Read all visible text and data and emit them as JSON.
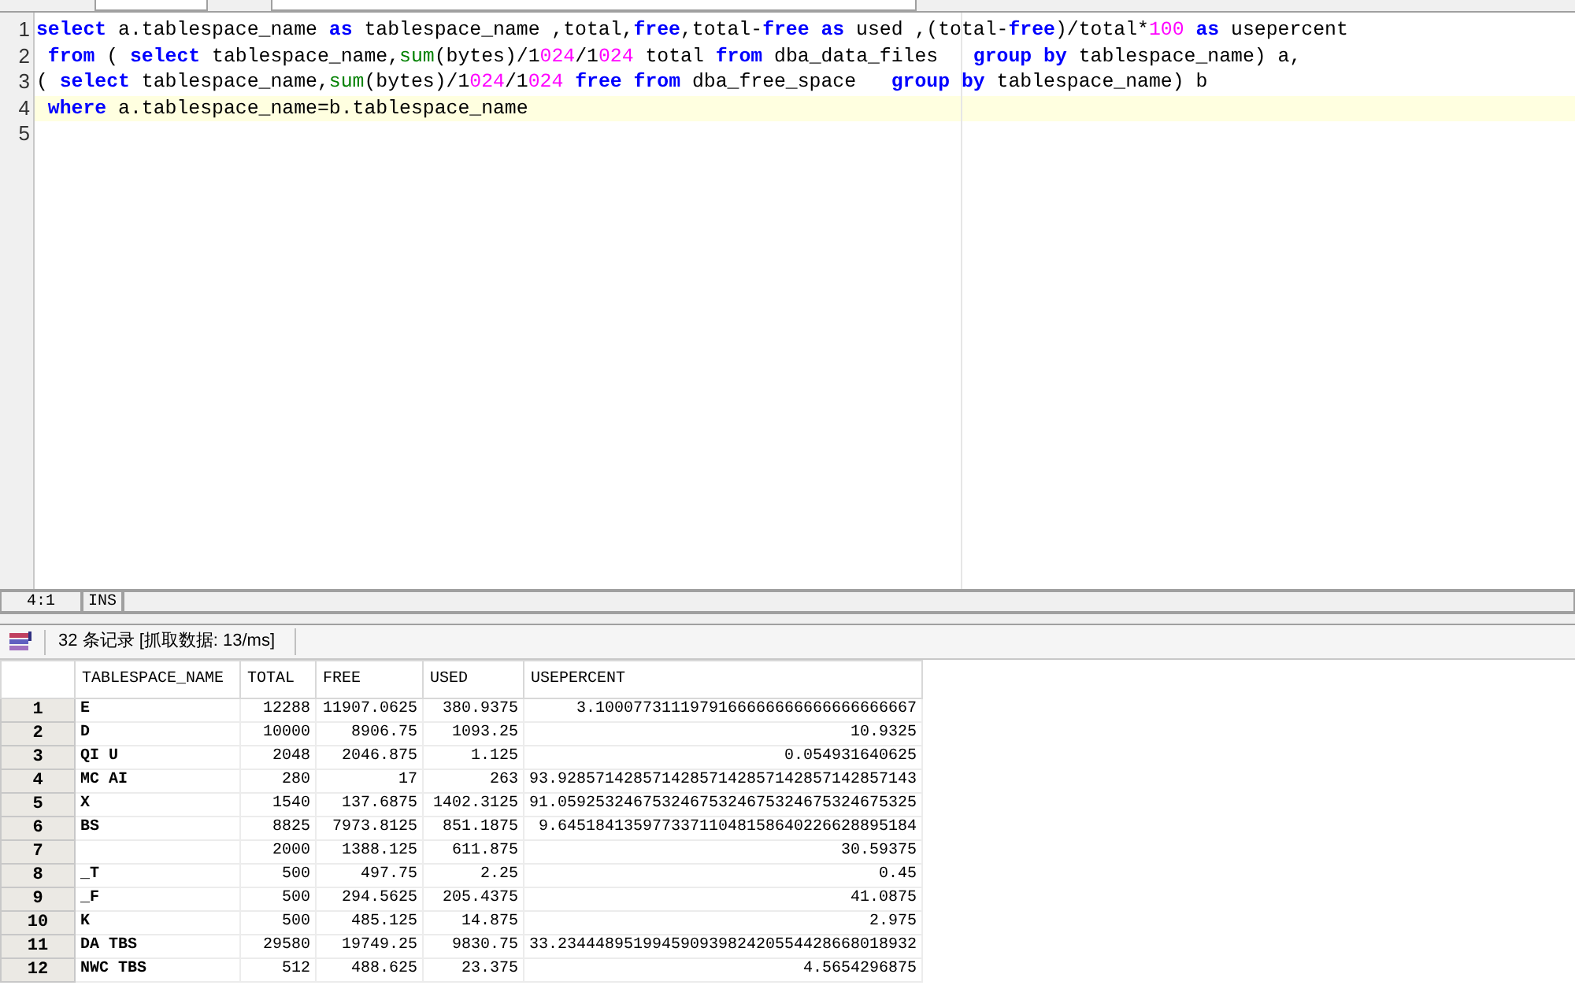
{
  "editor": {
    "lines": [
      {
        "number": "1",
        "current": false,
        "tokens": [
          {
            "kind": "keyword",
            "text": "select"
          },
          {
            "kind": "plain",
            "text": " a.tablespace_name "
          },
          {
            "kind": "keyword",
            "text": "as"
          },
          {
            "kind": "plain",
            "text": " tablespace_name ,total,"
          },
          {
            "kind": "keyword",
            "text": "free"
          },
          {
            "kind": "plain",
            "text": ",total-"
          },
          {
            "kind": "keyword",
            "text": "free"
          },
          {
            "kind": "keyword",
            "text": " as"
          },
          {
            "kind": "plain",
            "text": " used ,(total-"
          },
          {
            "kind": "keyword",
            "text": "free"
          },
          {
            "kind": "plain",
            "text": ")/total*"
          },
          {
            "kind": "number",
            "text": "100"
          },
          {
            "kind": "keyword",
            "text": " as"
          },
          {
            "kind": "plain",
            "text": " usepercent"
          }
        ]
      },
      {
        "number": "2",
        "current": false,
        "tokens": [
          {
            "kind": "keyword",
            "text": " from"
          },
          {
            "kind": "plain",
            "text": " ( "
          },
          {
            "kind": "keyword",
            "text": "select"
          },
          {
            "kind": "plain",
            "text": " tablespace_name,"
          },
          {
            "kind": "function",
            "text": "sum"
          },
          {
            "kind": "plain",
            "text": "(bytes)/1"
          },
          {
            "kind": "number",
            "text": "024"
          },
          {
            "kind": "plain",
            "text": "/1"
          },
          {
            "kind": "number",
            "text": "024"
          },
          {
            "kind": "plain",
            "text": " total "
          },
          {
            "kind": "keyword",
            "text": "from"
          },
          {
            "kind": "plain",
            "text": " dba_data_files   "
          },
          {
            "kind": "keyword",
            "text": "group"
          },
          {
            "kind": "keyword",
            "text": " by"
          },
          {
            "kind": "plain",
            "text": " tablespace_name) a,"
          }
        ]
      },
      {
        "number": "3",
        "current": false,
        "tokens": [
          {
            "kind": "plain",
            "text": "( "
          },
          {
            "kind": "keyword",
            "text": "select"
          },
          {
            "kind": "plain",
            "text": " tablespace_name,"
          },
          {
            "kind": "function",
            "text": "sum"
          },
          {
            "kind": "plain",
            "text": "(bytes)/1"
          },
          {
            "kind": "number",
            "text": "024"
          },
          {
            "kind": "plain",
            "text": "/1"
          },
          {
            "kind": "number",
            "text": "024"
          },
          {
            "kind": "keyword",
            "text": " free"
          },
          {
            "kind": "keyword",
            "text": " from"
          },
          {
            "kind": "plain",
            "text": " dba_free_space   "
          },
          {
            "kind": "keyword",
            "text": "group"
          },
          {
            "kind": "keyword",
            "text": " by"
          },
          {
            "kind": "plain",
            "text": " tablespace_name) b"
          }
        ]
      },
      {
        "number": "4",
        "current": true,
        "tokens": [
          {
            "kind": "keyword",
            "text": " where"
          },
          {
            "kind": "plain",
            "text": " a.tablespace_name=b.tablespace_name"
          }
        ]
      },
      {
        "number": "5",
        "current": false
      }
    ]
  },
  "status_bar": {
    "position": "4:1",
    "mode": "INS"
  },
  "results": {
    "summary": "32 条记录 [抓取数据: 13/ms]",
    "columns": [
      "TABLESPACE_NAME",
      "TOTAL",
      "FREE",
      "USED",
      "USEPERCENT"
    ],
    "rows": [
      {
        "number": "1",
        "cells": [
          "E",
          "12288",
          "11907.0625",
          "380.9375",
          "3.1000773111979166666666666666666667"
        ]
      },
      {
        "number": "2",
        "cells": [
          "D",
          "10000",
          "8906.75",
          "1093.25",
          "10.9325"
        ]
      },
      {
        "number": "3",
        "cells": [
          "QI U",
          "2048",
          "2046.875",
          "1.125",
          "0.054931640625"
        ]
      },
      {
        "number": "4",
        "cells": [
          "MC AI",
          "280",
          "17",
          "263",
          "93.92857142857142857142857142857142857143"
        ]
      },
      {
        "number": "5",
        "cells": [
          "X",
          "1540",
          "137.6875",
          "1402.3125",
          "91.05925324675324675324675324675324675325"
        ]
      },
      {
        "number": "6",
        "cells": [
          "BS",
          "8825",
          "7973.8125",
          "851.1875",
          "9.64518413597733711048158640226628895184"
        ]
      },
      {
        "number": "7",
        "cells": [
          "",
          "2000",
          "1388.125",
          "611.875",
          "30.59375"
        ]
      },
      {
        "number": "8",
        "cells": [
          "_T",
          "500",
          "497.75",
          "2.25",
          "0.45"
        ]
      },
      {
        "number": "9",
        "cells": [
          "_F",
          "500",
          "294.5625",
          "205.4375",
          "41.0875"
        ]
      },
      {
        "number": "10",
        "cells": [
          "K",
          "500",
          "485.125",
          "14.875",
          "2.975"
        ]
      },
      {
        "number": "11",
        "cells": [
          "DA TBS",
          "29580",
          "19749.25",
          "9830.75",
          "33.23444895199459093982420554428668018932"
        ]
      },
      {
        "number": "12",
        "cells": [
          "NWC TBS",
          "512",
          "488.625",
          "23.375",
          "4.5654296875"
        ]
      }
    ]
  }
}
